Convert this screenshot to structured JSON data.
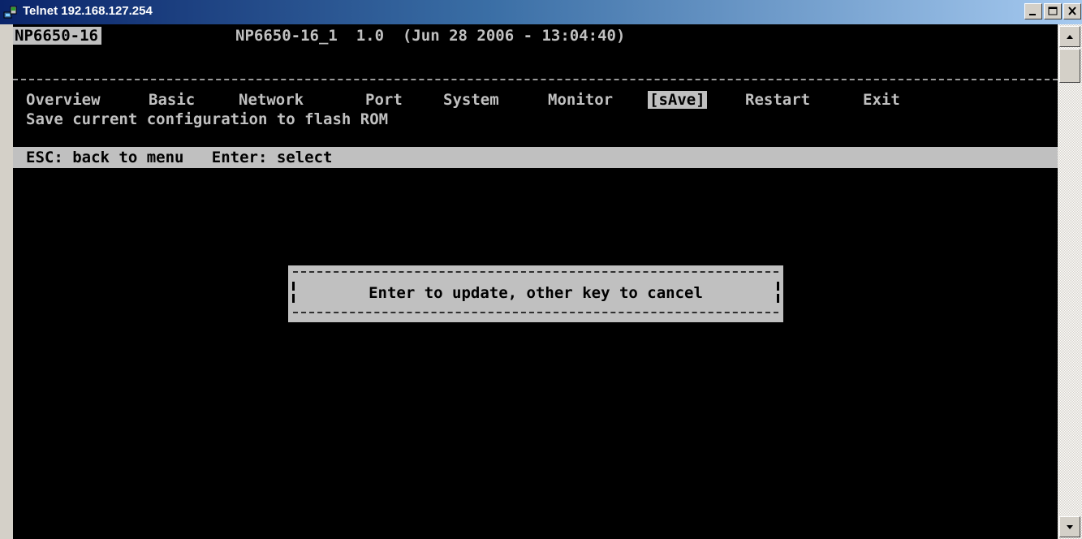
{
  "window": {
    "title": "Telnet 192.168.127.254",
    "icon": "telnet-icon"
  },
  "header": {
    "device_name": "NP6650-16",
    "info": "NP6650-16_1  1.0  (Jun 28 2006 - 13:04:40)"
  },
  "menu": {
    "items": [
      {
        "label": "Overview",
        "selected": false
      },
      {
        "label": "Basic",
        "selected": false
      },
      {
        "label": "Network",
        "selected": false
      },
      {
        "label": "Port",
        "selected": false
      },
      {
        "label": "System",
        "selected": false
      },
      {
        "label": "Monitor",
        "selected": false
      },
      {
        "label": "[sAve]",
        "selected": true
      },
      {
        "label": "Restart",
        "selected": false
      },
      {
        "label": "Exit",
        "selected": false
      }
    ],
    "description": "Save current configuration to flash ROM"
  },
  "status_bar": {
    "text": "ESC: back to menu   Enter: select"
  },
  "dialog": {
    "message": "Enter to update, other key to cancel"
  },
  "colors": {
    "terminal_bg": "#000000",
    "terminal_fg": "#c0c0c0",
    "highlight_bg": "#c0c0c0",
    "highlight_fg": "#000000",
    "titlebar_start": "#0a246a",
    "titlebar_end": "#a6caf0"
  }
}
